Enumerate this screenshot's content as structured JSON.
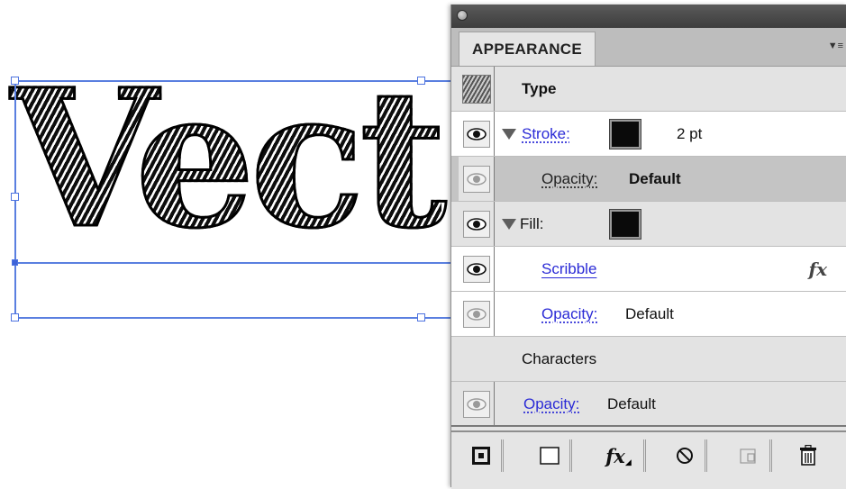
{
  "canvas": {
    "text": "Vect"
  },
  "panel": {
    "tab_label": "APPEARANCE",
    "menu_icon": "panel-menu-icon",
    "rows": {
      "type": {
        "label": "Type",
        "thumbnail_icon": "scribble-thumbnail"
      },
      "stroke": {
        "label": "Stroke:",
        "weight": "2 pt",
        "swatch_color": "#0a0a0a",
        "visible": true
      },
      "stroke_opacity": {
        "label": "Opacity:",
        "value": "Default",
        "visible": false
      },
      "fill": {
        "label": "Fill:",
        "swatch_color": "#0a0a0a",
        "visible": true
      },
      "scribble": {
        "label": "Scribble",
        "fx": "fx",
        "visible": true
      },
      "fill_opacity": {
        "label": "Opacity:",
        "value": "Default",
        "visible": false
      },
      "characters": {
        "label": "Characters"
      },
      "char_opacity": {
        "label": "Opacity:",
        "value": "Default",
        "visible": false
      }
    },
    "toolbar": {
      "add_stroke_icon": "add-new-stroke-icon",
      "add_fill_icon": "add-new-fill-icon",
      "fx_label": "fx",
      "clear_icon": "clear-appearance-icon",
      "duplicate_icon": "duplicate-item-icon",
      "delete_icon": "trash-icon"
    }
  },
  "colors": {
    "link": "#2b2bd6",
    "selection": "#4d73e0",
    "panel_bg": "#e5e5e5",
    "titlebar": "#4a4a4a"
  }
}
